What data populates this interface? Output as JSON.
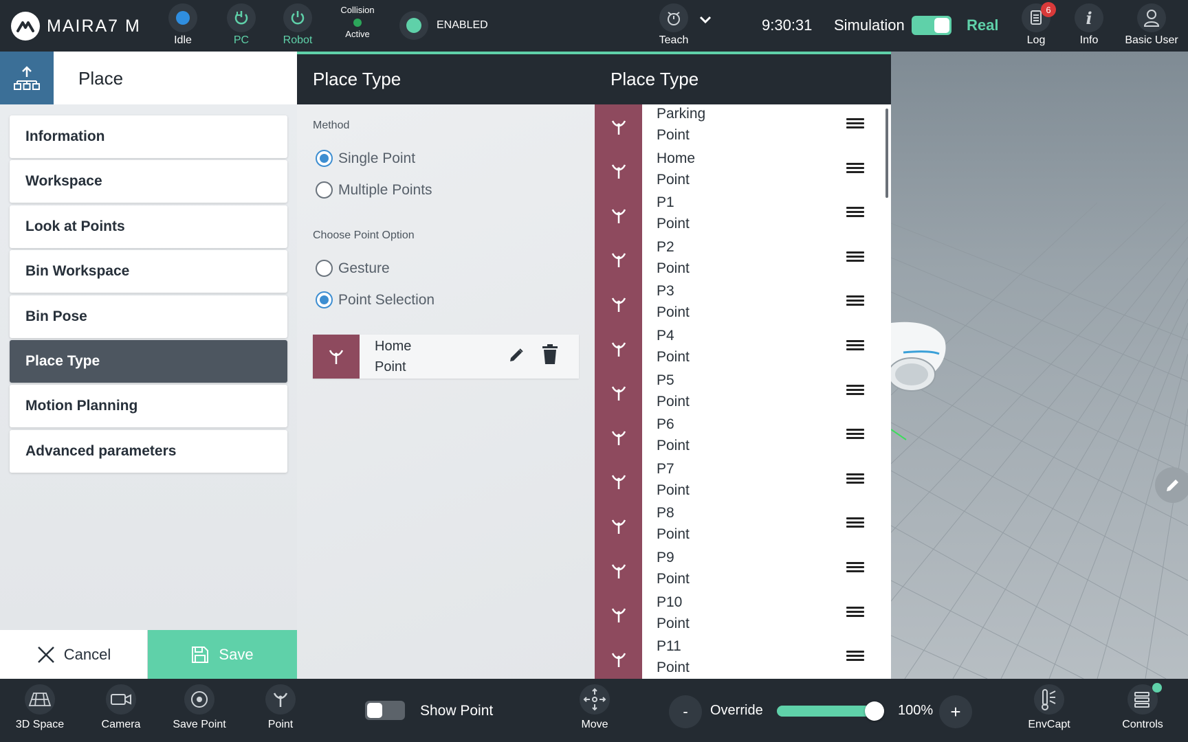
{
  "topbar": {
    "brand": "MAIRA7 M",
    "status_items": [
      {
        "label": "Idle",
        "icon": "status-dot-icon",
        "color": "#2f8ee0"
      },
      {
        "label": "PC",
        "icon": "power-cycle-icon",
        "color": "#5fd1a9"
      },
      {
        "label": "Robot",
        "icon": "power-icon",
        "color": "#5fd1a9"
      }
    ],
    "collision_title": "Collision",
    "collision_state": "Active",
    "enabled_label": "ENABLED",
    "teach_label": "Teach",
    "time": "9:30:31",
    "simulation_label": "Simulation",
    "real_label": "Real",
    "log_label": "Log",
    "log_badge": "6",
    "info_label": "Info",
    "user_label": "Basic User"
  },
  "left": {
    "title": "Place",
    "nav": [
      {
        "label": "Information"
      },
      {
        "label": "Workspace"
      },
      {
        "label": "Look at Points"
      },
      {
        "label": "Bin Workspace"
      },
      {
        "label": "Bin Pose"
      },
      {
        "label": "Place Type"
      },
      {
        "label": "Motion Planning"
      },
      {
        "label": "Advanced parameters"
      }
    ],
    "active_index": 5,
    "cancel_label": "Cancel",
    "save_label": "Save"
  },
  "middle": {
    "header_left": "Place Type",
    "header_right": "Place Type",
    "method_label": "Method",
    "method_options": [
      {
        "label": "Single Point",
        "checked": true
      },
      {
        "label": "Multiple Points",
        "checked": false
      }
    ],
    "point_option_label": "Choose Point Option",
    "point_options": [
      {
        "label": "Gesture",
        "checked": false
      },
      {
        "label": "Point Selection",
        "checked": true
      }
    ],
    "selected_point": {
      "name": "Home",
      "type": "Point"
    }
  },
  "points": [
    {
      "name": "Parking",
      "type": "Point"
    },
    {
      "name": "Home",
      "type": "Point"
    },
    {
      "name": "P1",
      "type": "Point"
    },
    {
      "name": "P2",
      "type": "Point"
    },
    {
      "name": "P3",
      "type": "Point"
    },
    {
      "name": "P4",
      "type": "Point"
    },
    {
      "name": "P5",
      "type": "Point"
    },
    {
      "name": "P6",
      "type": "Point"
    },
    {
      "name": "P7",
      "type": "Point"
    },
    {
      "name": "P8",
      "type": "Point"
    },
    {
      "name": "P9",
      "type": "Point"
    },
    {
      "name": "P10",
      "type": "Point"
    },
    {
      "name": "P11",
      "type": "Point"
    }
  ],
  "bottombar": {
    "space_label": "3D Space",
    "camera_label": "Camera",
    "save_point_label": "Save Point",
    "point_label": "Point",
    "show_point_label": "Show Point",
    "move_label": "Move",
    "override_minus": "-",
    "override_label": "Override",
    "override_value": "100%",
    "override_fraction": 1.0,
    "override_plus": "+",
    "envcapt_label": "EnvCapt",
    "controls_label": "Controls"
  },
  "colors": {
    "accent": "#5fd1a9",
    "point_color": "#8e4a5e",
    "selection_blue": "#3d8ed1"
  }
}
